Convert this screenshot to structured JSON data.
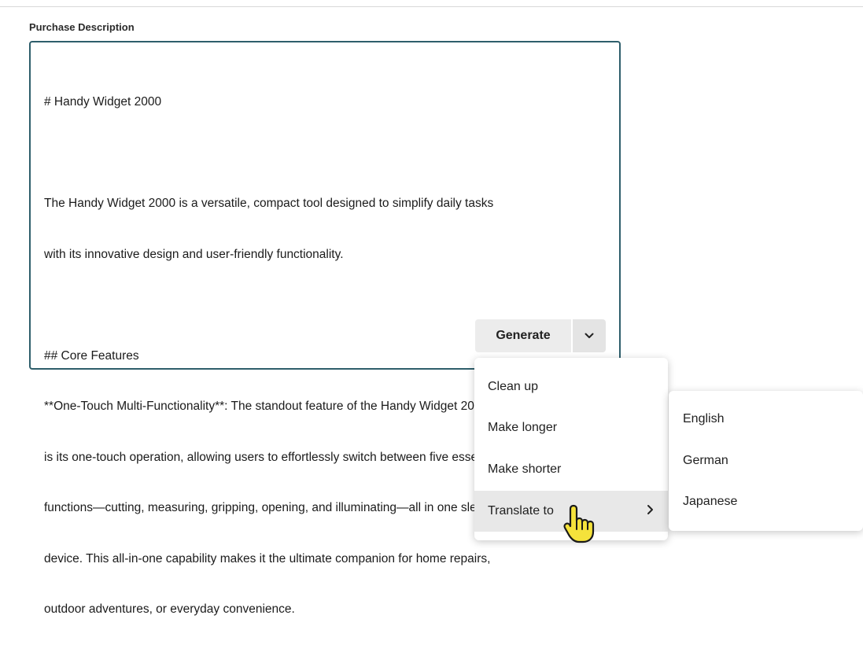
{
  "field": {
    "label": "Purchase Description",
    "lines": [
      "# Handy Widget 2000",
      "",
      "The Handy Widget 2000 is a versatile, compact tool designed to simplify daily tasks",
      "with its innovative design and user-friendly functionality.",
      "",
      "## Core Features",
      "**One-Touch Multi-Functionality**: The standout feature of the Handy Widget 2000",
      "is its one-touch operation, allowing users to effortlessly switch between five essential",
      "functions—cutting, measuring, gripping, opening, and illuminating—all in one sleek",
      "device. This all-in-one capability makes it the ultimate companion for home repairs,",
      "outdoor adventures, or everyday convenience."
    ]
  },
  "generate": {
    "label": "Generate",
    "chevron_icon": "chevron-down-icon"
  },
  "menu": {
    "items": [
      {
        "label": "Clean up"
      },
      {
        "label": "Make longer"
      },
      {
        "label": "Make shorter"
      },
      {
        "label": "Translate to",
        "submenu_icon": "chevron-right-icon"
      }
    ]
  },
  "submenu": {
    "items": [
      {
        "label": "English"
      },
      {
        "label": "German"
      },
      {
        "label": "Japanese"
      }
    ]
  },
  "colors": {
    "border_accent": "#2e5e6b",
    "menu_active_bg": "#e8e8e8",
    "cursor_fill": "#f5e23b"
  }
}
